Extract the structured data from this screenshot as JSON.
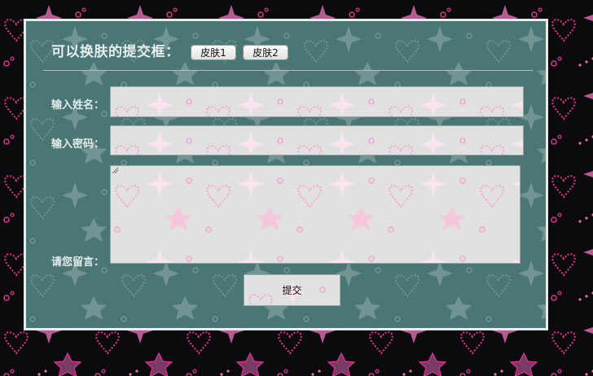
{
  "form": {
    "title": "可以换肤的提交框：",
    "skin_buttons": [
      "皮肤1",
      "皮肤2"
    ],
    "name_label": "输入姓名：",
    "password_label": "输入密码：",
    "message_label": "请您留言：",
    "name_value": "",
    "password_value": "",
    "message_value": "",
    "submit_label": "提交"
  },
  "theme": {
    "page_background": "#0b0b0d",
    "panel_background": "#4a7775",
    "accent_pink": "#e0338f",
    "field_background": "#e1e1e1"
  }
}
